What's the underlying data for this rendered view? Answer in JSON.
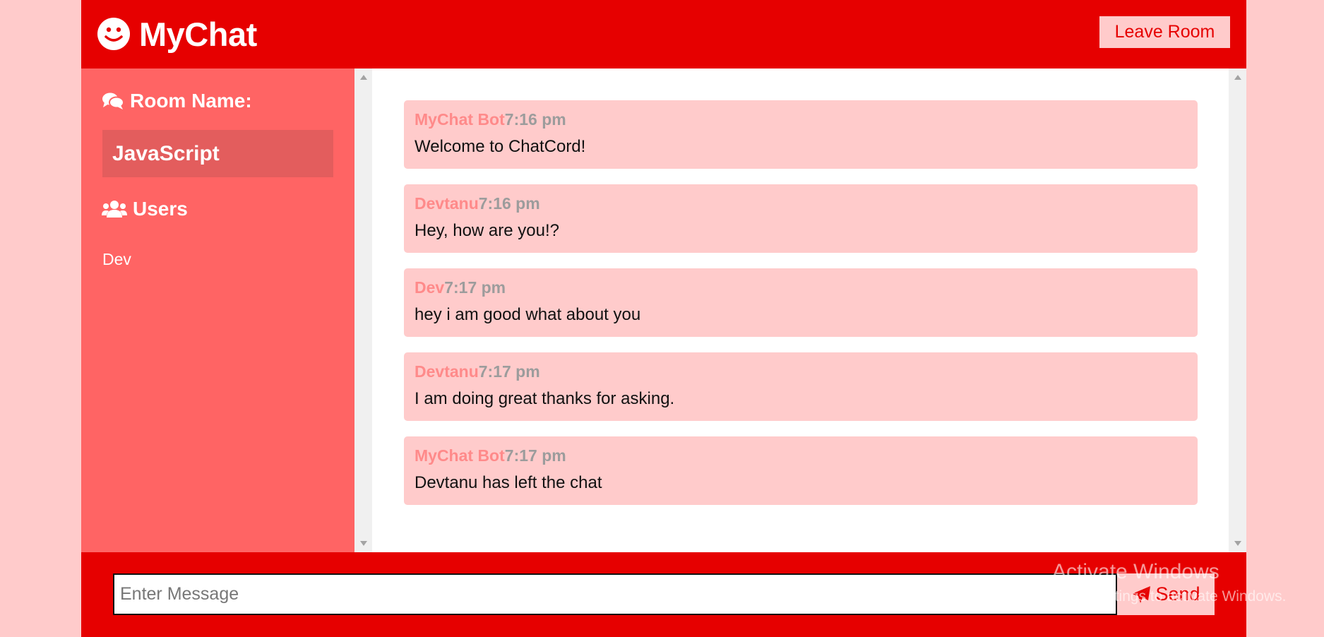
{
  "header": {
    "app_title": "MyChat",
    "leave_label": "Leave Room"
  },
  "sidebar": {
    "room_heading": "Room Name:",
    "room_name": "JavaScript",
    "users_heading": "Users",
    "users": [
      "Dev"
    ]
  },
  "messages": [
    {
      "user": "MyChat Bot",
      "time": "7:16 pm",
      "text": "Welcome to ChatCord!"
    },
    {
      "user": "Devtanu",
      "time": "7:16 pm",
      "text": "Hey, how are you!?"
    },
    {
      "user": "Dev",
      "time": "7:17 pm",
      "text": "hey i am good what about you"
    },
    {
      "user": "Devtanu",
      "time": "7:17 pm",
      "text": "I am doing great thanks for asking."
    },
    {
      "user": "MyChat Bot",
      "time": "7:17 pm",
      "text": "Devtanu has left the chat"
    }
  ],
  "composer": {
    "placeholder": "Enter Message",
    "value": "",
    "send_label": "Send"
  },
  "watermark": {
    "line1": "Activate Windows",
    "line2": "Go to Settings to activate Windows."
  },
  "colors": {
    "primary": "#e60000",
    "sidebar": "#ff6464",
    "light": "#ffcbcb",
    "username": "#ff8a8a",
    "timestamp": "#9c9c9c"
  },
  "icons": {
    "logo": "smile-icon",
    "room": "comments-icon",
    "users": "users-icon",
    "send": "paper-plane-icon"
  }
}
